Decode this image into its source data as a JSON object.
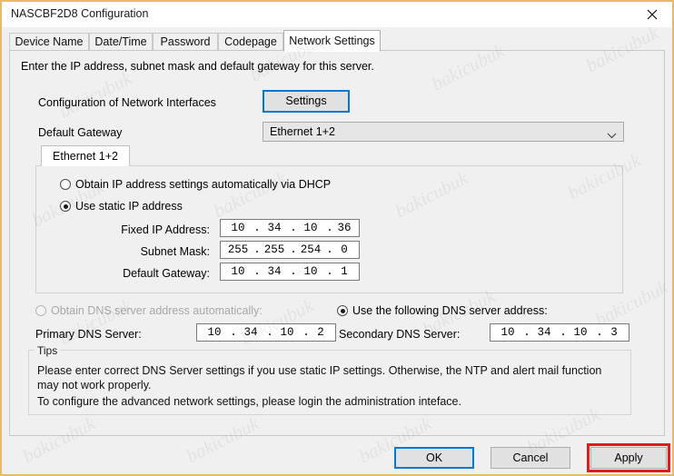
{
  "window": {
    "title": "NASCBF2D8 Configuration",
    "close_icon": "close-icon",
    "border_color": "#e8b96a"
  },
  "tabs": [
    {
      "label": "Device Name",
      "active": false
    },
    {
      "label": "Date/Time",
      "active": false
    },
    {
      "label": "Password",
      "active": false
    },
    {
      "label": "Codepage",
      "active": false
    },
    {
      "label": "Network Settings",
      "active": true
    }
  ],
  "main": {
    "intro": "Enter the IP address, subnet mask and default gateway for this server.",
    "config_interfaces_label": "Configuration of Network Interfaces",
    "settings_button": "Settings",
    "default_gateway_label": "Default Gateway",
    "default_gateway_value": "Ethernet 1+2",
    "chevron_icon": "chevron-down-icon"
  },
  "ethernet_group": {
    "tab_label": "Ethernet 1+2",
    "radio_dhcp": "Obtain IP address settings automatically via DHCP",
    "radio_static": "Use static IP address",
    "radio_static_selected": true,
    "fields": [
      {
        "label": "Fixed IP Address:",
        "octets": [
          "10",
          "34",
          "10",
          "36"
        ]
      },
      {
        "label": "Subnet Mask:",
        "octets": [
          "255",
          "255",
          "254",
          "0"
        ]
      },
      {
        "label": "Default Gateway:",
        "octets": [
          "10",
          "34",
          "10",
          "1"
        ]
      }
    ]
  },
  "dns": {
    "radio_auto": "Obtain DNS server address automatically:",
    "radio_auto_disabled": true,
    "radio_manual": "Use the following DNS server address:",
    "radio_manual_selected": true,
    "primary_label": "Primary DNS Server:",
    "primary_octets": [
      "10",
      "34",
      "10",
      "2"
    ],
    "secondary_label": "Secondary DNS Server:",
    "secondary_octets": [
      "10",
      "34",
      "10",
      "3"
    ]
  },
  "tips": {
    "legend": "Tips",
    "line1": "Please enter correct DNS Server settings if you use static IP settings.  Otherwise, the NTP and alert mail function",
    "line2": "may not work properly.",
    "line3": "To configure the advanced network settings, please login the administration inteface."
  },
  "footer": {
    "ok": "OK",
    "cancel": "Cancel",
    "apply": "Apply",
    "ok_focused": true,
    "apply_highlight_color": "#e01b1b"
  },
  "watermark": {
    "text": "bakicubuk"
  }
}
